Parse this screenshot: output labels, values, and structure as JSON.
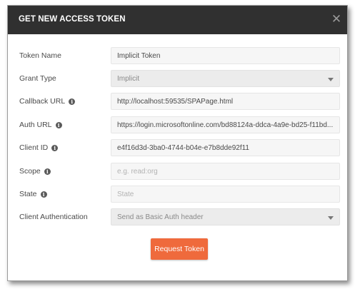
{
  "dialog": {
    "title": "GET NEW ACCESS TOKEN",
    "close_icon": "close-icon"
  },
  "form": {
    "token_name": {
      "label": "Token Name",
      "value": "Implicit Token"
    },
    "grant_type": {
      "label": "Grant Type",
      "value": "Implicit",
      "icon": "chevron-down-icon"
    },
    "callback_url": {
      "label": "Callback URL",
      "info_icon": "i",
      "value": "http://localhost:59535/SPAPage.html"
    },
    "auth_url": {
      "label": "Auth URL",
      "info_icon": "i",
      "value": "https://login.microsoftonline.com/bd88124a-ddca-4a9e-bd25-f11bd..."
    },
    "client_id": {
      "label": "Client ID",
      "info_icon": "i",
      "value": "e4f16d3d-3ba0-4744-b04e-e7b8dde92f11"
    },
    "scope": {
      "label": "Scope",
      "info_icon": "i",
      "placeholder": "e.g. read:org"
    },
    "state": {
      "label": "State",
      "info_icon": "i",
      "placeholder": "State"
    },
    "client_auth": {
      "label": "Client Authentication",
      "value": "Send as Basic Auth header",
      "icon": "chevron-down-icon"
    }
  },
  "actions": {
    "request_label": "Request Token",
    "accent_color": "#ef6a3c"
  },
  "colors": {
    "header_bg": "#303030",
    "field_bg": "#f6f6f6",
    "label_text": "#4a4a4a"
  }
}
